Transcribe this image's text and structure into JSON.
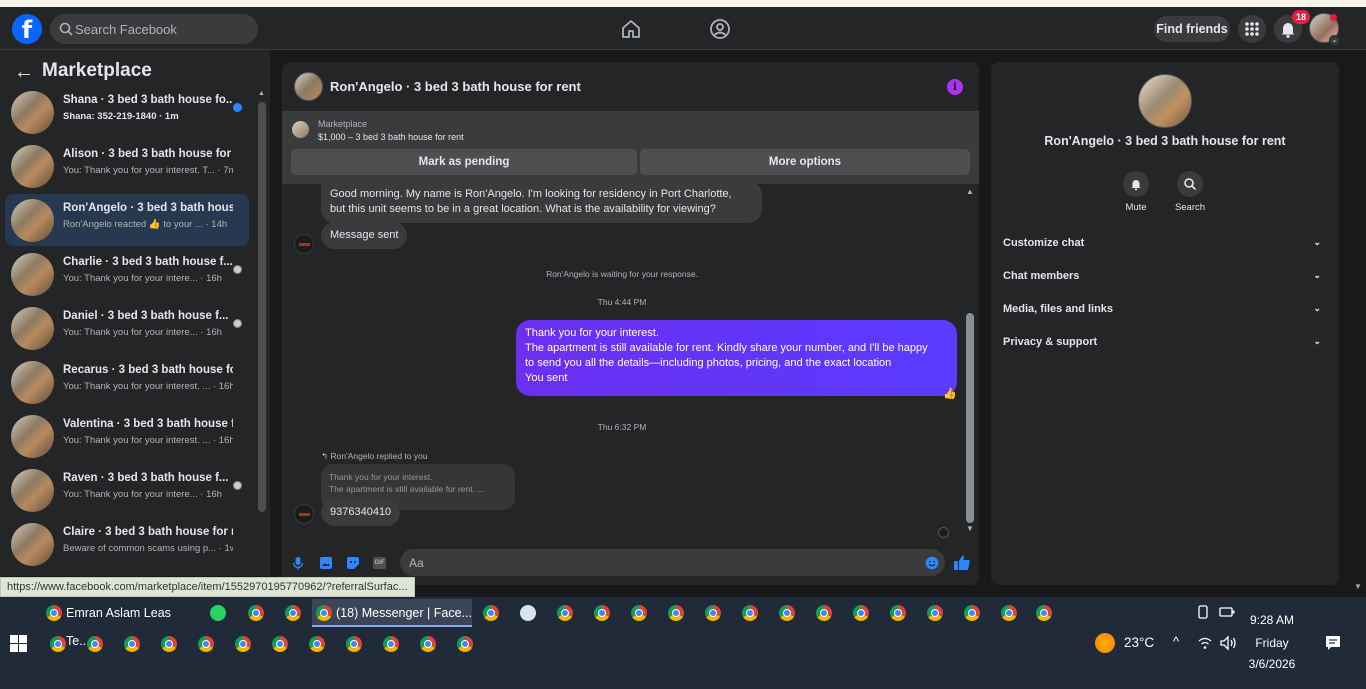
{
  "header": {
    "search_placeholder": "Search Facebook",
    "find_friends_label": "Find friends",
    "notification_count": "18"
  },
  "sidebar": {
    "title": "Marketplace",
    "conversations": [
      {
        "name": "Shana · 3 bed 3 bath house fo...",
        "sub": "Shana: 352-219-1840 · 1m",
        "unread": true,
        "status": "blue"
      },
      {
        "name": "Alison · 3 bed 3 bath house for ...",
        "sub": "You: Thank you for your interest. T... · 7m",
        "unread": false,
        "status": ""
      },
      {
        "name": "Ron'Angelo · 3 bed 3 bath hous...",
        "sub": "Ron'Angelo reacted 👍 to your ... · 14h",
        "unread": false,
        "status": "",
        "active": true
      },
      {
        "name": "Charlie · 3 bed 3 bath house f...",
        "sub": "You: Thank you for your intere... · 16h",
        "unread": false,
        "status": "avatar"
      },
      {
        "name": "Daniel · 3 bed 3 bath house f...",
        "sub": "You: Thank you for your intere... · 16h",
        "unread": false,
        "status": "avatar"
      },
      {
        "name": "Recarus · 3 bed 3 bath house fo...",
        "sub": "You: Thank you for your interest. ... · 16h",
        "unread": false,
        "status": ""
      },
      {
        "name": "Valentina · 3 bed 3 bath house f...",
        "sub": "You: Thank you for your interest. ... · 16h",
        "unread": false,
        "status": ""
      },
      {
        "name": "Raven · 3 bed 3 bath house f...",
        "sub": "You: Thank you for your intere... · 16h",
        "unread": false,
        "status": "avatar"
      },
      {
        "name": "Claire · 3 bed 3 bath house for r...",
        "sub": "Beware of common scams using p... · 1w",
        "unread": false,
        "status": ""
      }
    ]
  },
  "chat": {
    "title": "Ron'Angelo · 3 bed 3 bath house for rent",
    "listing_source": "Marketplace",
    "listing_price": "$1,000 – 3 bed 3 bath house for rent",
    "btn_pending": "Mark as pending",
    "btn_more": "More options",
    "messages": {
      "first_line1": "Good morning. My name is Ron'Angelo. I'm looking for residency in Port Charlotte,",
      "first_line2": "but this unit seems to be in a great location. What is the availability for viewing?",
      "message_sent": "Message sent",
      "waiting_notice": "Ron'Angelo is waiting for your response.",
      "time1": "Thu 4:44 PM",
      "out_line1": "Thank you for your interest.",
      "out_line2": "The apartment is still available for rent. Kindly share your number, and I'll be happy",
      "out_line3": "to send you all the details—including photos, pricing, and the exact location",
      "out_line4": "You sent",
      "time2": "Thu 6:32 PM",
      "reply_label": "Ron'Angelo replied to you",
      "quoted_line1": "Thank you for your interest.",
      "quoted_line2": "The apartment is still available for rent. ...",
      "phone": "9376340410"
    },
    "composer_placeholder": "Aa"
  },
  "info_panel": {
    "name": "Ron'Angelo · 3 bed 3 bath house for rent",
    "mute_label": "Mute",
    "search_label": "Search",
    "rows": [
      "Customize chat",
      "Chat members",
      "Media, files and links",
      "Privacy & support"
    ]
  },
  "url_tooltip": "https://www.facebook.com/marketplace/item/1552970195770962/?referralSurfac...",
  "taskbar": {
    "app1": "Emran Aslam Leas Te...",
    "app2": "(18) Messenger | Face...",
    "temperature": "23°C",
    "time": "9:28 AM",
    "day": "Friday",
    "date": "3/6/2026"
  },
  "colors": {
    "accent": "#0866ff",
    "outgoing_bubble": "#5a3bff",
    "info_icon": "#a933f0",
    "notification": "#e41e3f"
  }
}
